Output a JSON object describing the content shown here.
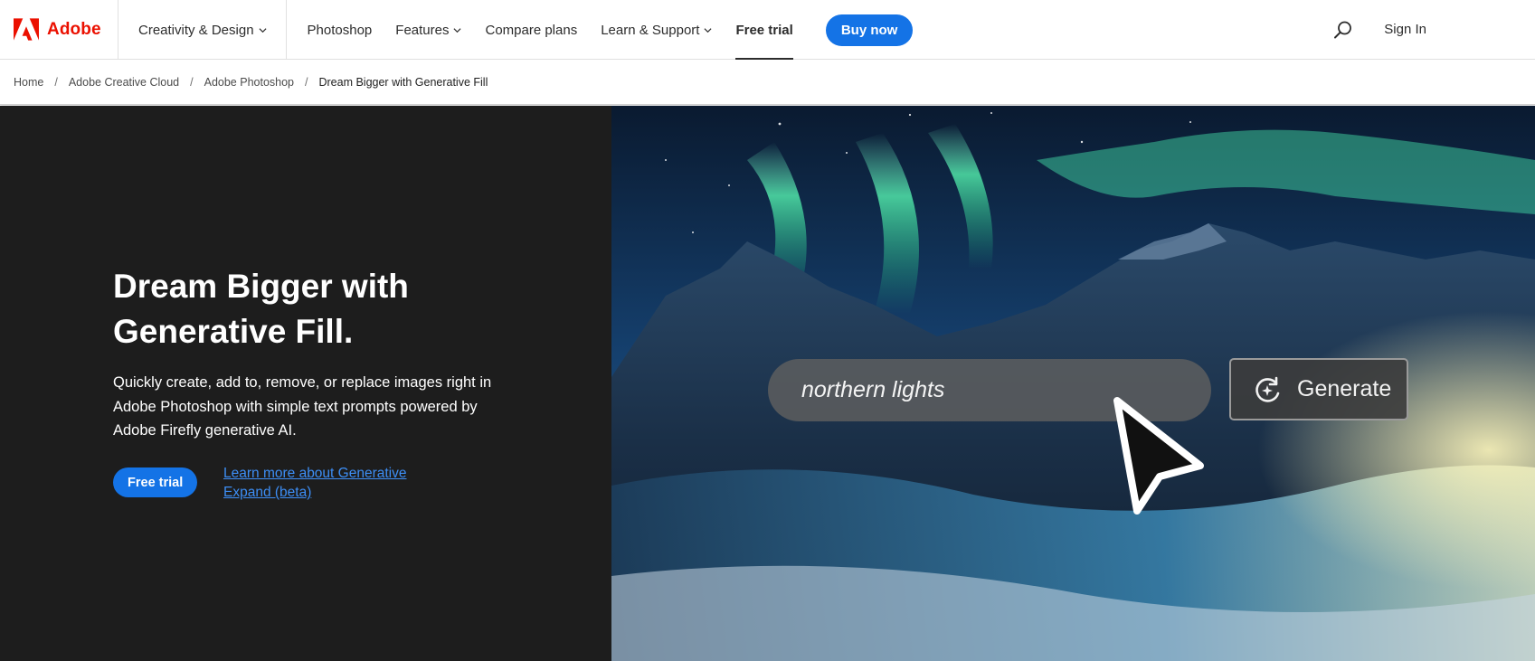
{
  "brand": {
    "name": "Adobe",
    "logo_icon": "adobe-logo-icon",
    "color": "#eb1000"
  },
  "nav": {
    "group_label": "Creativity & Design",
    "items": [
      {
        "label": "Photoshop",
        "dropdown": false
      },
      {
        "label": "Features",
        "dropdown": true
      },
      {
        "label": "Compare plans",
        "dropdown": false
      },
      {
        "label": "Learn & Support",
        "dropdown": true
      },
      {
        "label": "Free trial",
        "dropdown": false,
        "active": true
      }
    ],
    "buy_label": "Buy now",
    "search_icon": "search-icon",
    "signin_label": "Sign In",
    "accent": "#1473e6"
  },
  "breadcrumb": [
    "Home",
    "Adobe Creative Cloud",
    "Adobe Photoshop",
    "Dream Bigger with Generative Fill"
  ],
  "breadcrumb_separator": "/",
  "hero": {
    "title": "Dream Bigger with Generative Fill.",
    "body": "Quickly create, add to, remove, or replace images right in Adobe Photoshop with simple text prompts powered by Adobe Firefly generative AI.",
    "cta_label": "Free trial",
    "link_label": "Learn more about Generative Expand (beta)",
    "panel_color": "#1d1d1d",
    "prompt_text": "northern lights",
    "generate_label": "Generate",
    "generate_icon": "generative-refresh-icon",
    "pointer_icon": "mouse-pointer-icon"
  }
}
